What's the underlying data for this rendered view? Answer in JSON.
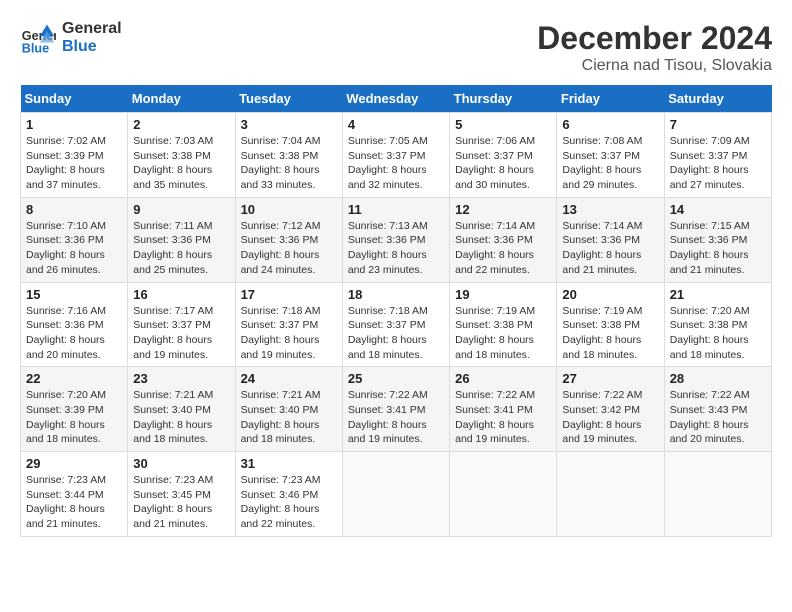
{
  "header": {
    "logo_line1": "General",
    "logo_line2": "Blue",
    "month": "December 2024",
    "location": "Cierna nad Tisou, Slovakia"
  },
  "weekdays": [
    "Sunday",
    "Monday",
    "Tuesday",
    "Wednesday",
    "Thursday",
    "Friday",
    "Saturday"
  ],
  "weeks": [
    [
      {
        "day": "1",
        "sunrise": "Sunrise: 7:02 AM",
        "sunset": "Sunset: 3:39 PM",
        "daylight": "Daylight: 8 hours and 37 minutes."
      },
      {
        "day": "2",
        "sunrise": "Sunrise: 7:03 AM",
        "sunset": "Sunset: 3:38 PM",
        "daylight": "Daylight: 8 hours and 35 minutes."
      },
      {
        "day": "3",
        "sunrise": "Sunrise: 7:04 AM",
        "sunset": "Sunset: 3:38 PM",
        "daylight": "Daylight: 8 hours and 33 minutes."
      },
      {
        "day": "4",
        "sunrise": "Sunrise: 7:05 AM",
        "sunset": "Sunset: 3:37 PM",
        "daylight": "Daylight: 8 hours and 32 minutes."
      },
      {
        "day": "5",
        "sunrise": "Sunrise: 7:06 AM",
        "sunset": "Sunset: 3:37 PM",
        "daylight": "Daylight: 8 hours and 30 minutes."
      },
      {
        "day": "6",
        "sunrise": "Sunrise: 7:08 AM",
        "sunset": "Sunset: 3:37 PM",
        "daylight": "Daylight: 8 hours and 29 minutes."
      },
      {
        "day": "7",
        "sunrise": "Sunrise: 7:09 AM",
        "sunset": "Sunset: 3:37 PM",
        "daylight": "Daylight: 8 hours and 27 minutes."
      }
    ],
    [
      {
        "day": "8",
        "sunrise": "Sunrise: 7:10 AM",
        "sunset": "Sunset: 3:36 PM",
        "daylight": "Daylight: 8 hours and 26 minutes."
      },
      {
        "day": "9",
        "sunrise": "Sunrise: 7:11 AM",
        "sunset": "Sunset: 3:36 PM",
        "daylight": "Daylight: 8 hours and 25 minutes."
      },
      {
        "day": "10",
        "sunrise": "Sunrise: 7:12 AM",
        "sunset": "Sunset: 3:36 PM",
        "daylight": "Daylight: 8 hours and 24 minutes."
      },
      {
        "day": "11",
        "sunrise": "Sunrise: 7:13 AM",
        "sunset": "Sunset: 3:36 PM",
        "daylight": "Daylight: 8 hours and 23 minutes."
      },
      {
        "day": "12",
        "sunrise": "Sunrise: 7:14 AM",
        "sunset": "Sunset: 3:36 PM",
        "daylight": "Daylight: 8 hours and 22 minutes."
      },
      {
        "day": "13",
        "sunrise": "Sunrise: 7:14 AM",
        "sunset": "Sunset: 3:36 PM",
        "daylight": "Daylight: 8 hours and 21 minutes."
      },
      {
        "day": "14",
        "sunrise": "Sunrise: 7:15 AM",
        "sunset": "Sunset: 3:36 PM",
        "daylight": "Daylight: 8 hours and 21 minutes."
      }
    ],
    [
      {
        "day": "15",
        "sunrise": "Sunrise: 7:16 AM",
        "sunset": "Sunset: 3:36 PM",
        "daylight": "Daylight: 8 hours and 20 minutes."
      },
      {
        "day": "16",
        "sunrise": "Sunrise: 7:17 AM",
        "sunset": "Sunset: 3:37 PM",
        "daylight": "Daylight: 8 hours and 19 minutes."
      },
      {
        "day": "17",
        "sunrise": "Sunrise: 7:18 AM",
        "sunset": "Sunset: 3:37 PM",
        "daylight": "Daylight: 8 hours and 19 minutes."
      },
      {
        "day": "18",
        "sunrise": "Sunrise: 7:18 AM",
        "sunset": "Sunset: 3:37 PM",
        "daylight": "Daylight: 8 hours and 18 minutes."
      },
      {
        "day": "19",
        "sunrise": "Sunrise: 7:19 AM",
        "sunset": "Sunset: 3:38 PM",
        "daylight": "Daylight: 8 hours and 18 minutes."
      },
      {
        "day": "20",
        "sunrise": "Sunrise: 7:19 AM",
        "sunset": "Sunset: 3:38 PM",
        "daylight": "Daylight: 8 hours and 18 minutes."
      },
      {
        "day": "21",
        "sunrise": "Sunrise: 7:20 AM",
        "sunset": "Sunset: 3:38 PM",
        "daylight": "Daylight: 8 hours and 18 minutes."
      }
    ],
    [
      {
        "day": "22",
        "sunrise": "Sunrise: 7:20 AM",
        "sunset": "Sunset: 3:39 PM",
        "daylight": "Daylight: 8 hours and 18 minutes."
      },
      {
        "day": "23",
        "sunrise": "Sunrise: 7:21 AM",
        "sunset": "Sunset: 3:40 PM",
        "daylight": "Daylight: 8 hours and 18 minutes."
      },
      {
        "day": "24",
        "sunrise": "Sunrise: 7:21 AM",
        "sunset": "Sunset: 3:40 PM",
        "daylight": "Daylight: 8 hours and 18 minutes."
      },
      {
        "day": "25",
        "sunrise": "Sunrise: 7:22 AM",
        "sunset": "Sunset: 3:41 PM",
        "daylight": "Daylight: 8 hours and 19 minutes."
      },
      {
        "day": "26",
        "sunrise": "Sunrise: 7:22 AM",
        "sunset": "Sunset: 3:41 PM",
        "daylight": "Daylight: 8 hours and 19 minutes."
      },
      {
        "day": "27",
        "sunrise": "Sunrise: 7:22 AM",
        "sunset": "Sunset: 3:42 PM",
        "daylight": "Daylight: 8 hours and 19 minutes."
      },
      {
        "day": "28",
        "sunrise": "Sunrise: 7:22 AM",
        "sunset": "Sunset: 3:43 PM",
        "daylight": "Daylight: 8 hours and 20 minutes."
      }
    ],
    [
      {
        "day": "29",
        "sunrise": "Sunrise: 7:23 AM",
        "sunset": "Sunset: 3:44 PM",
        "daylight": "Daylight: 8 hours and 21 minutes."
      },
      {
        "day": "30",
        "sunrise": "Sunrise: 7:23 AM",
        "sunset": "Sunset: 3:45 PM",
        "daylight": "Daylight: 8 hours and 21 minutes."
      },
      {
        "day": "31",
        "sunrise": "Sunrise: 7:23 AM",
        "sunset": "Sunset: 3:46 PM",
        "daylight": "Daylight: 8 hours and 22 minutes."
      },
      null,
      null,
      null,
      null
    ]
  ]
}
